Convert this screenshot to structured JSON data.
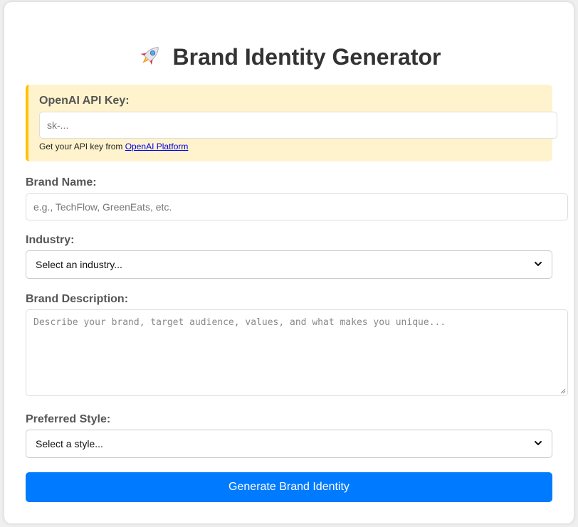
{
  "header": {
    "title": "Brand Identity Generator",
    "icon": "rocket-icon"
  },
  "api_key": {
    "label": "OpenAI API Key:",
    "placeholder": "sk-...",
    "value": "",
    "help_prefix": "Get your API key from ",
    "help_link": "OpenAI Platform"
  },
  "brand_name": {
    "label": "Brand Name:",
    "placeholder": "e.g., TechFlow, GreenEats, etc.",
    "value": ""
  },
  "industry": {
    "label": "Industry:",
    "selected": "Select an industry..."
  },
  "description": {
    "label": "Brand Description:",
    "placeholder": "Describe your brand, target audience, values, and what makes you unique...",
    "value": ""
  },
  "style": {
    "label": "Preferred Style:",
    "selected": "Select a style..."
  },
  "actions": {
    "generate_label": "Generate Brand Identity"
  },
  "colors": {
    "primary": "#007bff",
    "warning_bg": "#fff3cd",
    "warning_border": "#ffc107",
    "label_text": "#555555",
    "title_text": "#333333"
  }
}
